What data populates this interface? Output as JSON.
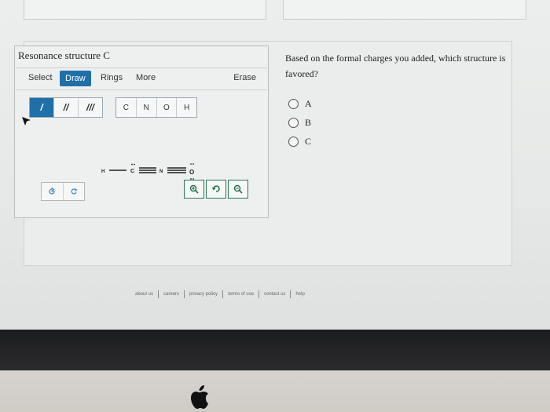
{
  "sketch": {
    "title": "Resonance structure C",
    "tabs": [
      "Select",
      "Draw",
      "Rings",
      "More"
    ],
    "active_tab": "Draw",
    "erase_label": "Erase",
    "bond_tools": [
      "/",
      "//",
      "///"
    ],
    "atom_tools": [
      "C",
      "N",
      "O",
      "H"
    ],
    "molecule": {
      "atoms": [
        "H",
        "C",
        "N",
        "O"
      ],
      "text": "H—C̈≡N≡Ö"
    },
    "undo_icons": [
      "undo-icon",
      "redo-icon"
    ],
    "zoom_icons": [
      "zoom-in-icon",
      "reset-zoom-icon",
      "zoom-out-icon"
    ]
  },
  "question": {
    "text": "Based on the formal charges you added, which structure is favored?",
    "options": [
      "A",
      "B",
      "C"
    ]
  },
  "footer": {
    "links": [
      "about us",
      "careers",
      "privacy policy",
      "terms of use",
      "contact us",
      "help"
    ]
  },
  "colors": {
    "accent": "#1f6fa8",
    "zoom": "#1f6e4c",
    "bezel": "#1c1d1f"
  }
}
